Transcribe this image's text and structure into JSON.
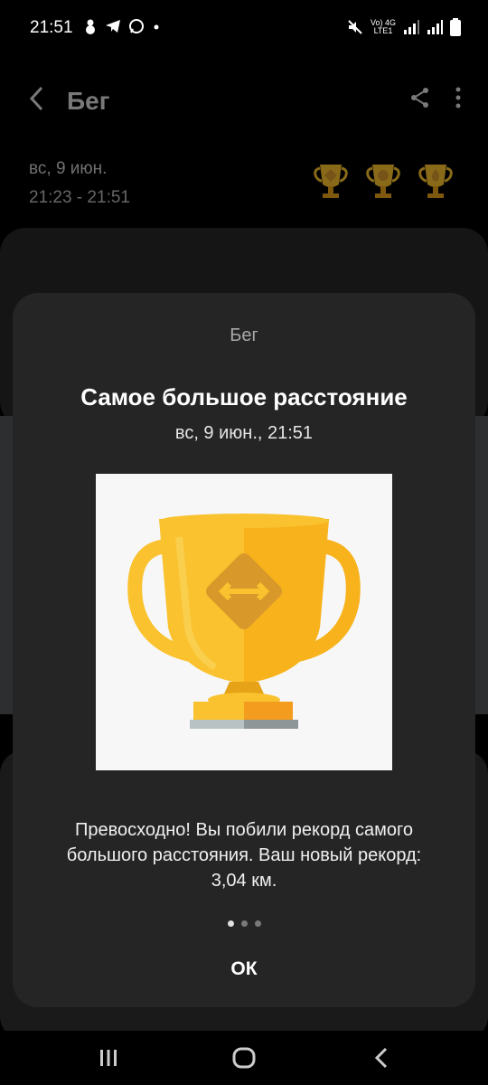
{
  "status_bar": {
    "time": "21:51",
    "notification_icons": [
      "snowman-icon",
      "telegram-icon",
      "whatsapp-icon",
      "dot-icon"
    ],
    "network_top": "Vo) 4G",
    "network_bottom": "LTE1"
  },
  "app_bar": {
    "title": "Бег",
    "back_icon": "chevron-left-icon",
    "share_icon": "share-icon",
    "more_icon": "more-vert-icon"
  },
  "session": {
    "date": "вс, 9 июн.",
    "time_range": "21:23 - 21:51"
  },
  "dialog": {
    "category": "Бег",
    "title": "Самое большое расстояние",
    "date": "вс, 9 июн., 21:51",
    "message": "Превосходно! Вы побили рекорд самого большого расстояния. Ваш новый рекорд: 3,04 км.",
    "ok_label": "ОК",
    "page_count": 3,
    "current_page": 1
  },
  "colors": {
    "trophy_gold": "#f9c22e",
    "trophy_dark": "#e6a318",
    "badge": "#d9982a",
    "dialog_bg": "#252525"
  }
}
